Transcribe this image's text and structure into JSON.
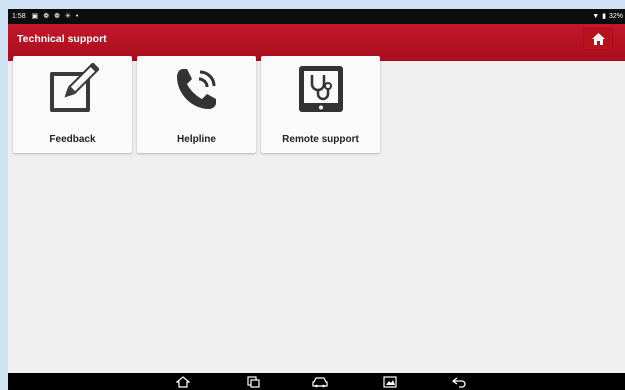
{
  "status_bar": {
    "time": "1:58",
    "icons": [
      "image-icon",
      "gear-icon",
      "gear-icon",
      "sync-icon",
      "dot-icon"
    ],
    "battery_text": "32%"
  },
  "header": {
    "title": "Technical support",
    "home_icon": "home-icon"
  },
  "tiles": [
    {
      "label": "Feedback",
      "icon": "pencil-edit-icon"
    },
    {
      "label": "Helpline",
      "icon": "phone-ringing-icon"
    },
    {
      "label": "Remote support",
      "icon": "stethoscope-tablet-icon"
    }
  ],
  "nav_bar": {
    "icons": [
      "home-icon",
      "recent-apps-icon",
      "car-icon",
      "screenshot-icon",
      "back-icon"
    ]
  },
  "colors": {
    "header_red": "#b8121f",
    "page_bg": "#efefef",
    "tile_bg": "#fafafa",
    "icon_dark": "#333333"
  }
}
